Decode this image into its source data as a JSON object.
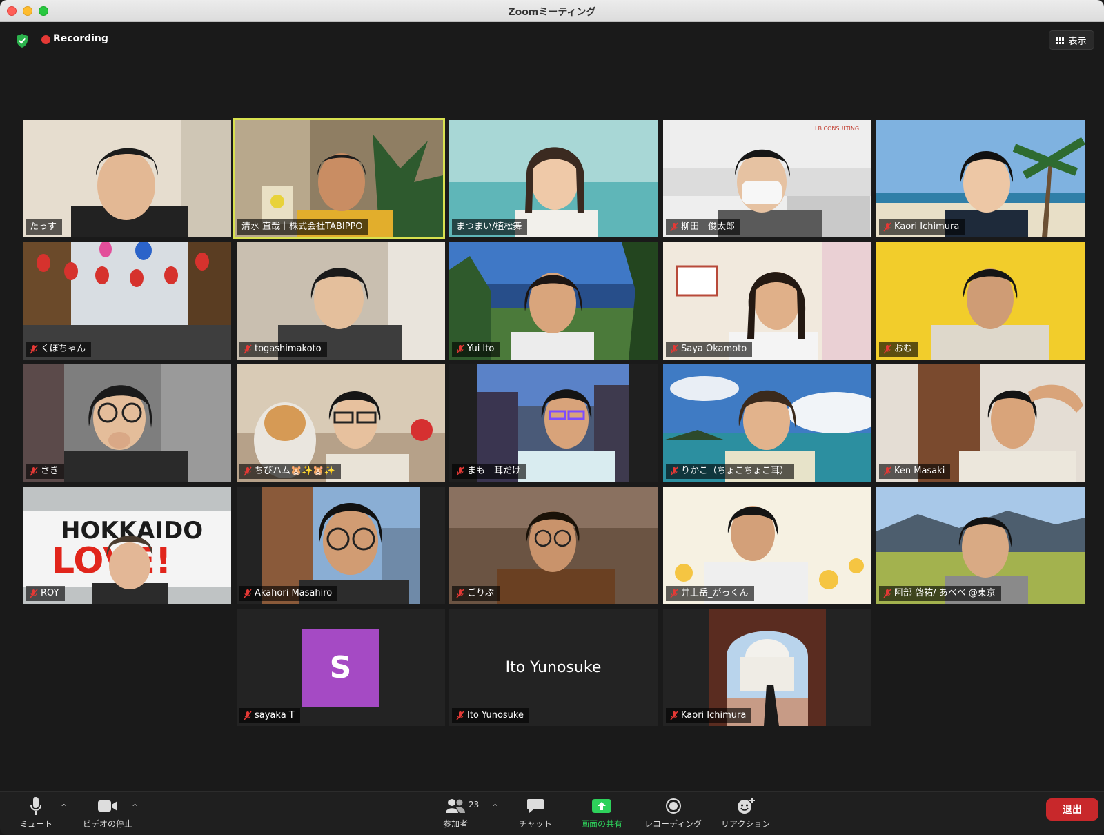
{
  "window": {
    "title": "Zoomミーティング"
  },
  "top": {
    "recording_label": "Recording",
    "view_label": "表示"
  },
  "participants": [
    {
      "name": "たっす"
    },
    {
      "name": "清水 直哉｜株式会社TABIPPO"
    },
    {
      "name": "まつまい/植松舞"
    },
    {
      "name": "柳田　俊太郎"
    },
    {
      "name": "Kaori Ichimura"
    },
    {
      "name": "くぼちゃん"
    },
    {
      "name": "togashimakoto"
    },
    {
      "name": "Yui Ito"
    },
    {
      "name": "Saya Okamoto"
    },
    {
      "name": "おむ"
    },
    {
      "name": "さき"
    },
    {
      "name": "ちびハム🐹✨🐹✨"
    },
    {
      "name": "まも　耳だけ"
    },
    {
      "name": "りかこ（ちょこちょこ耳）"
    },
    {
      "name": "Ken Masaki"
    },
    {
      "name": "ROY"
    },
    {
      "name": "Akahori Masahiro"
    },
    {
      "name": "ごりぶ"
    },
    {
      "name": "井上岳_がっくん"
    },
    {
      "name": "阿部 啓祐/ あべべ @東京"
    },
    {
      "name": "sayaka T",
      "avatar_letter": "S"
    },
    {
      "name": "Ito Yunosuke",
      "display_text": "Ito Yunosuke"
    },
    {
      "name": "Kaori Ichimura"
    }
  ],
  "scene_text": {
    "hokkaido": "HOKKAIDO",
    "love": "LOVE!",
    "consulting": "LB CONSULTING"
  },
  "toolbar": {
    "mute": "ミュート",
    "video": "ビデオの停止",
    "participants": "参加者",
    "participant_count": "23",
    "chat": "チャット",
    "share": "画面の共有",
    "record": "レコーディング",
    "reactions": "リアクション",
    "leave": "退出"
  },
  "colors": {
    "active_speaker": "#d8e14f",
    "share_green": "#2ed15b",
    "leave_red": "#c8282b",
    "avatar_purple": "#a54ac4"
  }
}
